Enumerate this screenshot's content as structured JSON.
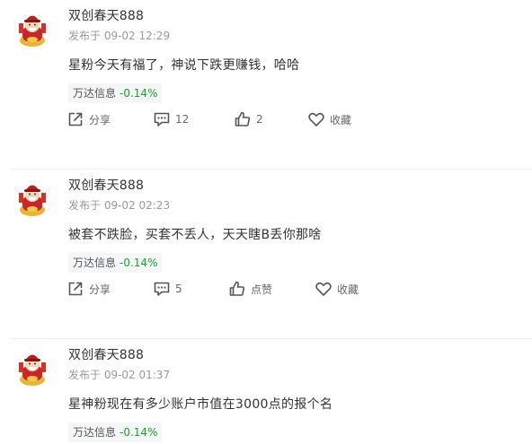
{
  "posts": [
    {
      "username": "双创春天888",
      "time": "发布于 09-02 12:29",
      "content": "星粉今天有福了，神说下跌更赚钱，哈哈",
      "stock": {
        "name": "万达信息",
        "change": "-0.14%"
      },
      "actions": {
        "share": "分享",
        "comment": "12",
        "like": "2",
        "favorite": "收藏"
      }
    },
    {
      "username": "双创春天888",
      "time": "发布于 09-02 02:23",
      "content": "被套不跌脸，买套不丢人，天天瞎B丢你那啥",
      "stock": {
        "name": "万达信息",
        "change": "-0.14%"
      },
      "actions": {
        "share": "分享",
        "comment": "5",
        "like": "点赞",
        "favorite": "收藏"
      }
    },
    {
      "username": "双创春天888",
      "time": "发布于 09-02 01:37",
      "content": "星神粉现在有多少账户市值在3000点的报个名",
      "stock": {
        "name": "万达信息",
        "change": "-0.14%"
      }
    }
  ],
  "colors": {
    "stock_change": "#1aa32c",
    "text_primary": "#333333",
    "text_secondary": "#999999",
    "tag_background": "#f4f6f8",
    "avatar_red": "#c8262b"
  },
  "icons": [
    "avatar-caishen-icon",
    "share-icon",
    "comment-icon",
    "like-icon",
    "favorite-heart-icon"
  ]
}
